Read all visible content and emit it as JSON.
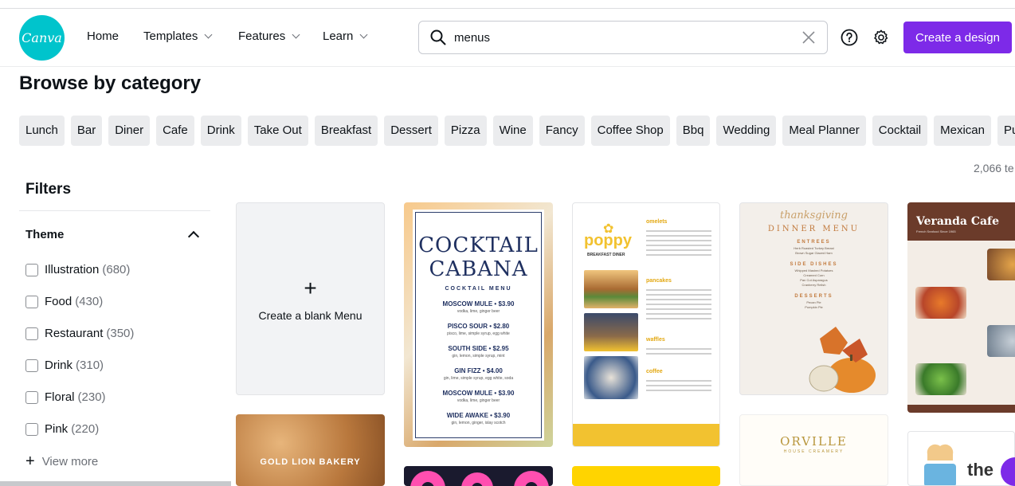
{
  "brand": {
    "logo_text": "Canva",
    "accent": "#7d2ae8",
    "logo_color": "#00c4cc"
  },
  "nav": {
    "home": "Home",
    "templates": "Templates",
    "features": "Features",
    "learn": "Learn"
  },
  "search": {
    "value": "menus",
    "placeholder": "Search"
  },
  "header_actions": {
    "help_icon": "help-circle-icon",
    "settings_icon": "gear-icon",
    "create_label": "Create a design"
  },
  "browse": {
    "title": "Browse by category",
    "categories": [
      "Lunch",
      "Bar",
      "Diner",
      "Cafe",
      "Drink",
      "Take Out",
      "Breakfast",
      "Dessert",
      "Pizza",
      "Wine",
      "Fancy",
      "Coffee Shop",
      "Bbq",
      "Wedding",
      "Meal Planner",
      "Cocktail",
      "Mexican",
      "Pub"
    ]
  },
  "results_count": "2,066 te",
  "filters": {
    "title": "Filters",
    "theme_label": "Theme",
    "items": [
      {
        "label": "Illustration",
        "count": "(680)"
      },
      {
        "label": "Food",
        "count": "(430)"
      },
      {
        "label": "Restaurant",
        "count": "(350)"
      },
      {
        "label": "Drink",
        "count": "(310)"
      },
      {
        "label": "Floral",
        "count": "(230)"
      },
      {
        "label": "Pink",
        "count": "(220)"
      }
    ],
    "view_more": "View more"
  },
  "templates": {
    "blank_label": "Create a blank Menu",
    "cocktail": {
      "title_line1": "COCKTAIL",
      "title_line2": "CABANA",
      "subtitle": "COCKTAIL MENU",
      "items": [
        {
          "name": "MOSCOW MULE • $3.90",
          "desc": "vodka, lime, ginger beer"
        },
        {
          "name": "PISCO SOUR • $2.80",
          "desc": "pisco, lime, simple syrup, egg white"
        },
        {
          "name": "SOUTH SIDE • $2.95",
          "desc": "gin, lemon, simple syrup, mint"
        },
        {
          "name": "GIN FIZZ • $4.00",
          "desc": "gin, lime, simple syrup, egg white, soda"
        },
        {
          "name": "MOSCOW MULE • $3.90",
          "desc": "vodka, lime, ginger beer"
        },
        {
          "name": "WIDE AWAKE • $3.90",
          "desc": "gin, lemon, ginger, islay scotch"
        }
      ]
    },
    "poppy": {
      "name": "poppy",
      "tag": "BREAKFAST DINER",
      "sections": [
        "omelets",
        "pancakes",
        "waffles",
        "coffee"
      ]
    },
    "thanksgiving": {
      "script": "thanksgiving",
      "title": "DINNER MENU",
      "sections": [
        {
          "name": "ENTREES",
          "lines": "Herb Roasted Turkey Breast\nBrown Sugar Glazed Ham"
        },
        {
          "name": "SIDE DISHES",
          "lines": "Whipped Mashed Potatoes\nCreamed Corn\nPan Cut Asparagus\nCranberry Relish"
        },
        {
          "name": "DESSERTS",
          "lines": "Pecan Pie\nPumpkin Pie"
        }
      ]
    },
    "veranda": {
      "name": "Veranda Cafe",
      "tag": "French Seafood Since 1965"
    },
    "bakery": {
      "name": "GOLD LION BAKERY"
    },
    "orville": {
      "name": "ORVILLE",
      "tag": "HOUSE CREAMERY"
    },
    "thecard": {
      "text": "the"
    }
  }
}
